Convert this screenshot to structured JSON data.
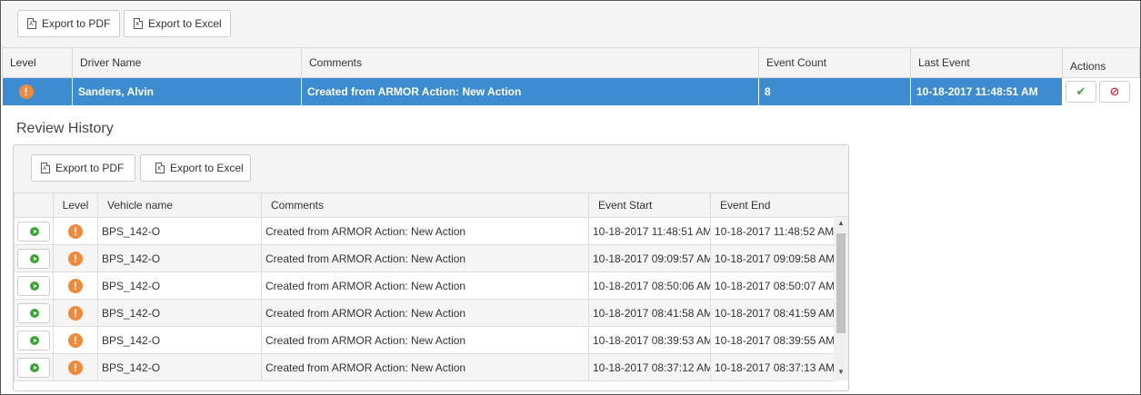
{
  "toolbar": {
    "export_pdf_label": "Export to PDF",
    "export_excel_label": "Export to Excel"
  },
  "main_table": {
    "columns": [
      "Level",
      "Driver Name",
      "Comments",
      "Event Count",
      "Last Event",
      "Actions"
    ],
    "row": {
      "level_icon": "exclamation-alert-icon",
      "level_glyph": "!",
      "driver_name": "Sanders, Alvin",
      "comments": "Created from ARMOR Action: New Action",
      "event_count": "8",
      "last_event": "10-18-2017 11:48:51 AM"
    },
    "actions": {
      "approve_glyph": "✔",
      "reject_glyph": "⊘"
    }
  },
  "review_history": {
    "title": "Review History",
    "export_pdf_label": "Export to PDF",
    "export_excel_label": "Export to Excel",
    "columns": [
      "",
      "Level",
      "Vehicle name",
      "Comments",
      "Event Start",
      "Event End"
    ],
    "rows": [
      {
        "level_glyph": "!",
        "vehicle": "BPS_142-O",
        "comments": "Created from ARMOR Action: New Action",
        "start": "10-18-2017 11:48:51 AM",
        "end": "10-18-2017 11:48:52 AM"
      },
      {
        "level_glyph": "!",
        "vehicle": "BPS_142-O",
        "comments": "Created from ARMOR Action: New Action",
        "start": "10-18-2017 09:09:57 AM",
        "end": "10-18-2017 09:09:58 AM"
      },
      {
        "level_glyph": "!",
        "vehicle": "BPS_142-O",
        "comments": "Created from ARMOR Action: New Action",
        "start": "10-18-2017 08:50:06 AM",
        "end": "10-18-2017 08:50:07 AM"
      },
      {
        "level_glyph": "!",
        "vehicle": "BPS_142-O",
        "comments": "Created from ARMOR Action: New Action",
        "start": "10-18-2017 08:41:58 AM",
        "end": "10-18-2017 08:41:59 AM"
      },
      {
        "level_glyph": "!",
        "vehicle": "BPS_142-O",
        "comments": "Created from ARMOR Action: New Action",
        "start": "10-18-2017 08:39:53 AM",
        "end": "10-18-2017 08:39:55 AM"
      },
      {
        "level_glyph": "!",
        "vehicle": "BPS_142-O",
        "comments": "Created from ARMOR Action: New Action",
        "start": "10-18-2017 08:37:12 AM",
        "end": "10-18-2017 08:37:13 AM"
      }
    ]
  },
  "colors": {
    "selected_row": "#3d8bd0",
    "alert": "#f08a3a",
    "play": "#3aa535",
    "approve": "#3aa535",
    "reject": "#d9303a"
  }
}
